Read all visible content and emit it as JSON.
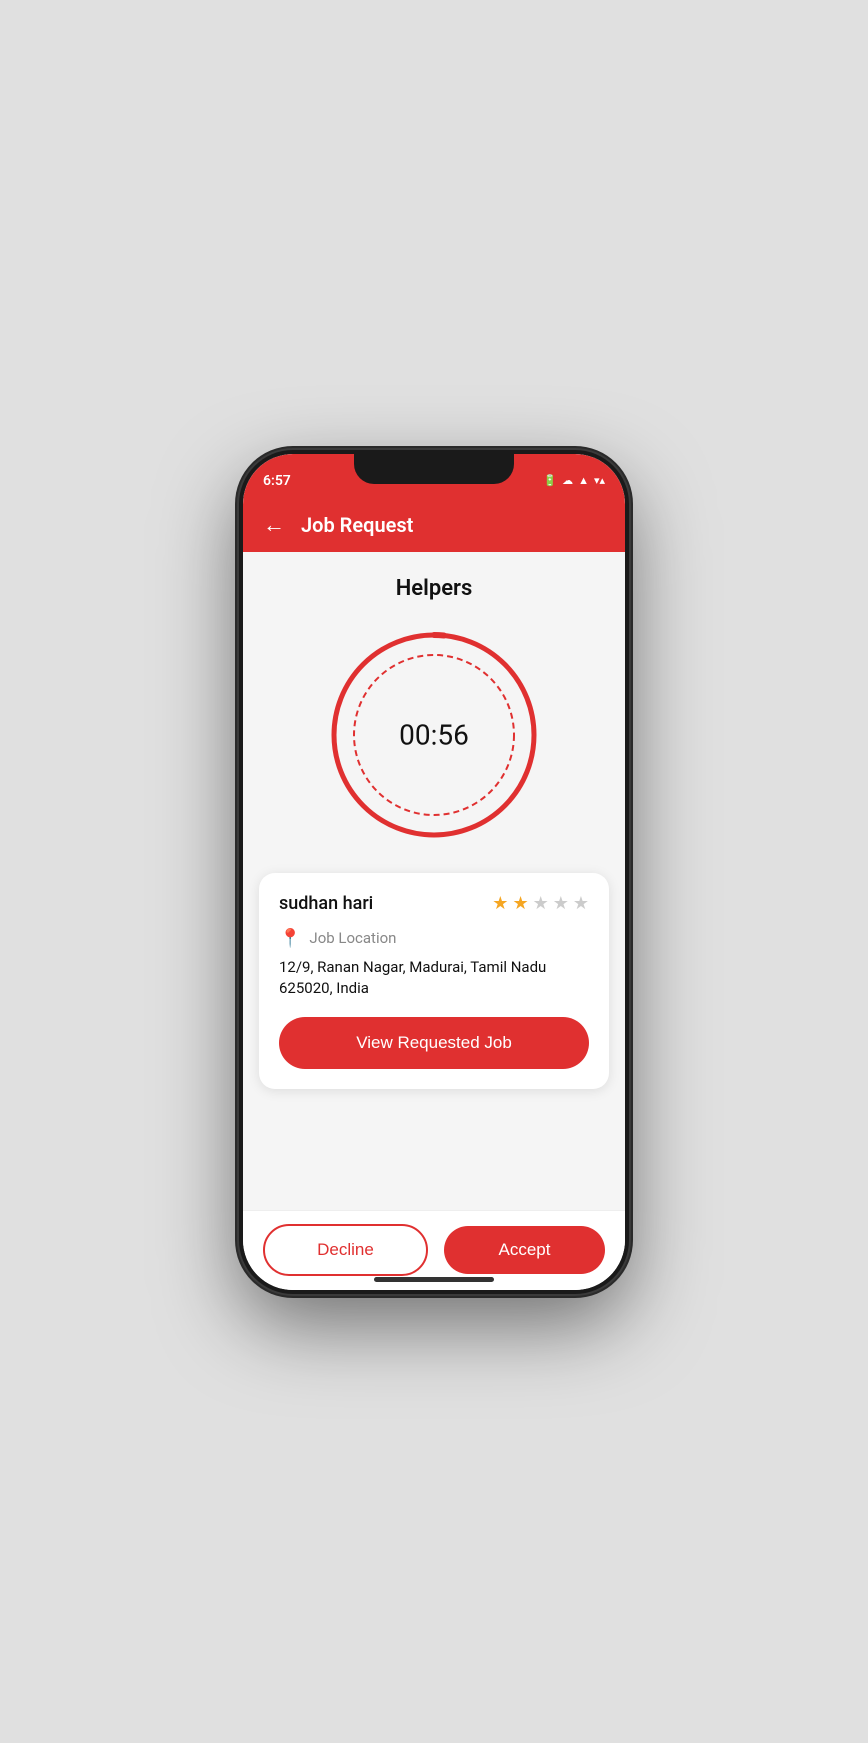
{
  "statusBar": {
    "time": "6:57",
    "icons": [
      "battery",
      "cloud-check",
      "signal",
      "wifi",
      "signal-bars"
    ]
  },
  "header": {
    "title": "Job Request",
    "back_label": "←"
  },
  "main": {
    "section_title": "Helpers",
    "timer": {
      "display": "00:56",
      "progress": 56,
      "total": 60
    },
    "job_card": {
      "helper_name": "sudhan hari",
      "rating": 2,
      "max_rating": 5,
      "location_label": "Job Location",
      "location_address": "12/9, Ranan Nagar, Madurai, Tamil Nadu 625020, India",
      "view_job_button_label": "View Requested Job"
    }
  },
  "footer": {
    "decline_label": "Decline",
    "accept_label": "Accept"
  },
  "colors": {
    "primary": "#e03030",
    "star_filled": "#f5a623",
    "star_empty": "#cccccc"
  }
}
